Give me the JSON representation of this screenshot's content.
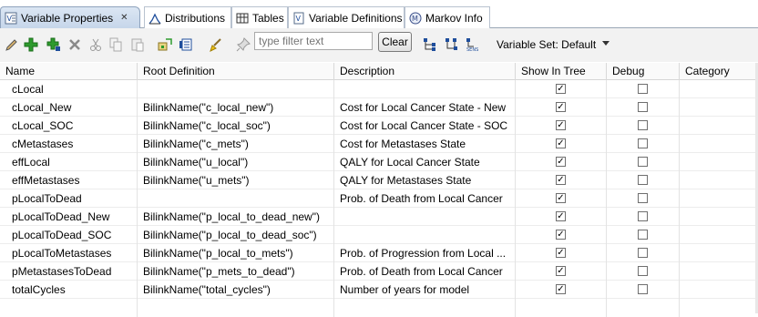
{
  "tabs": [
    {
      "label": "Variable Properties",
      "icon": "variable-properties-icon",
      "active": true,
      "closable": true
    },
    {
      "label": "Distributions",
      "icon": "distributions-icon"
    },
    {
      "label": "Tables",
      "icon": "tables-icon"
    },
    {
      "label": "Variable Definitions",
      "icon": "variable-definitions-icon"
    },
    {
      "label": "Markov Info",
      "icon": "markov-info-icon"
    }
  ],
  "toolbar": {
    "filter_placeholder": "type filter text",
    "clear_label": "Clear",
    "variable_set_label": "Variable Set: Default",
    "icons": [
      "edit-icon",
      "add-icon",
      "add-child-icon",
      "delete-icon",
      "cut-icon",
      "copy-icon",
      "paste-icon",
      "import-icon",
      "export-icon",
      "clean-icon",
      "pin-icon",
      "tree-layout-icon",
      "tree-expand-icon",
      "sens-analysis-icon"
    ]
  },
  "table": {
    "columns": [
      "Name",
      "Root Definition",
      "Description",
      "Show In Tree",
      "Debug",
      "Category"
    ],
    "rows": [
      {
        "name": "cLocal",
        "root": "",
        "desc": "",
        "show": true,
        "debug": false,
        "category": ""
      },
      {
        "name": "cLocal_New",
        "root": "BilinkName(\"c_local_new\")",
        "desc": "Cost for Local Cancer State - New",
        "show": true,
        "debug": false,
        "category": ""
      },
      {
        "name": "cLocal_SOC",
        "root": "BilinkName(\"c_local_soc\")",
        "desc": "Cost for Local Cancer State - SOC",
        "show": true,
        "debug": false,
        "category": ""
      },
      {
        "name": "cMetastases",
        "root": "BilinkName(\"c_mets\")",
        "desc": "Cost for Metastases State",
        "show": true,
        "debug": false,
        "category": ""
      },
      {
        "name": "effLocal",
        "root": "BilinkName(\"u_local\")",
        "desc": "QALY for Local Cancer State",
        "show": true,
        "debug": false,
        "category": ""
      },
      {
        "name": "effMetastases",
        "root": "BilinkName(\"u_mets\")",
        "desc": "QALY for Metastases State",
        "show": true,
        "debug": false,
        "category": ""
      },
      {
        "name": "pLocalToDead",
        "root": "",
        "desc": "Prob. of Death from Local Cancer",
        "show": true,
        "debug": false,
        "category": ""
      },
      {
        "name": "pLocalToDead_New",
        "root": "BilinkName(\"p_local_to_dead_new\")",
        "desc": "",
        "show": true,
        "debug": false,
        "category": ""
      },
      {
        "name": "pLocalToDead_SOC",
        "root": "BilinkName(\"p_local_to_dead_soc\")",
        "desc": "",
        "show": true,
        "debug": false,
        "category": ""
      },
      {
        "name": "pLocalToMetastases",
        "root": "BilinkName(\"p_local_to_mets\")",
        "desc": "Prob. of Progression from Local ...",
        "show": true,
        "debug": false,
        "category": ""
      },
      {
        "name": "pMetastasesToDead",
        "root": "BilinkName(\"p_mets_to_dead\")",
        "desc": "Prob. of Death from Local Cancer",
        "show": true,
        "debug": false,
        "category": ""
      },
      {
        "name": "totalCycles",
        "root": "BilinkName(\"total_cycles\")",
        "desc": "Number of years for model",
        "show": true,
        "debug": false,
        "category": ""
      }
    ]
  },
  "colors": {
    "tab_active": "#c6d6ea",
    "toolbar_bg": "#f2f2f2",
    "add_green": "#2e9b2e",
    "delete_gray": "#8a8a8a"
  }
}
